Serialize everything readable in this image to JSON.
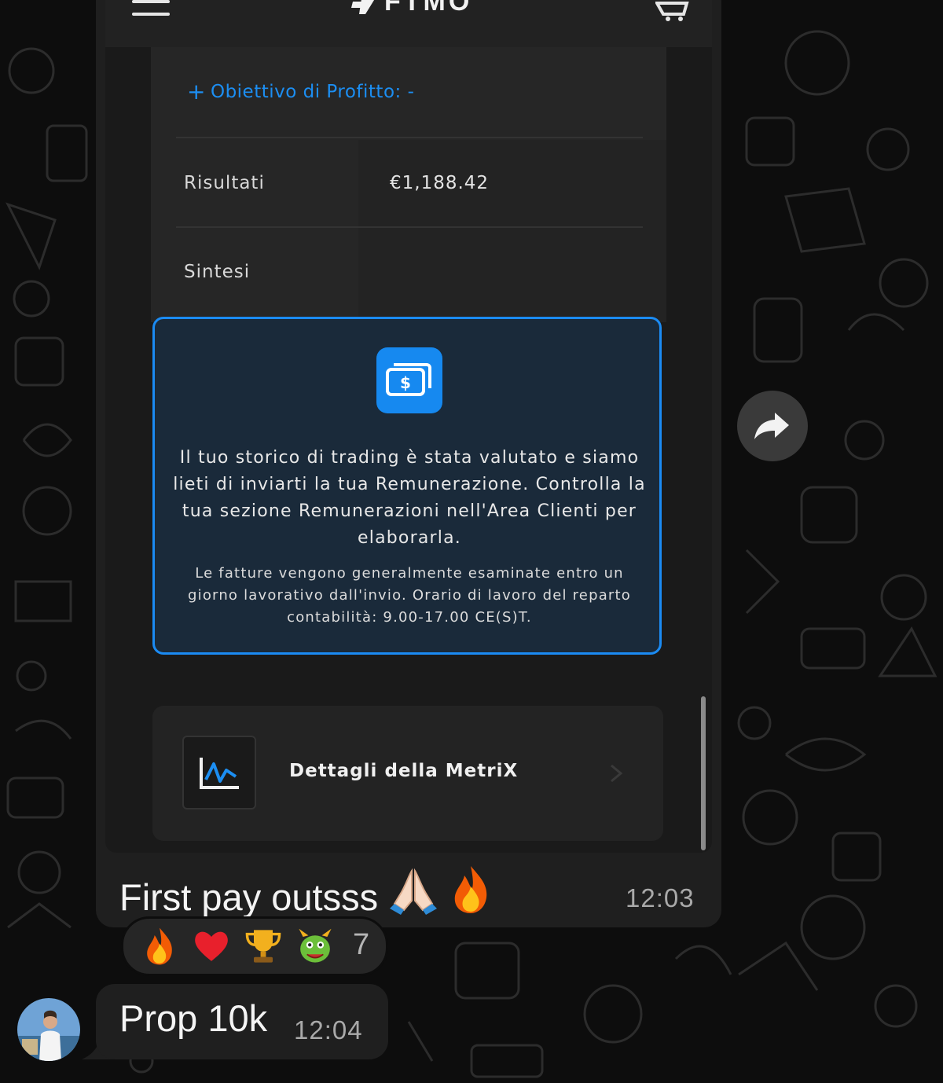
{
  "fake_app": {
    "logo_text": "FTMO",
    "profit_target": "Obiettivo di Profitto: -",
    "rows": [
      {
        "label": "Risultati",
        "value": "€1,188.42"
      },
      {
        "label": "Sintesi",
        "value": ""
      }
    ],
    "info_main": "Il tuo storico di trading è stata valutato e siamo lieti di inviarti la tua Remunerazione. Controlla la tua sezione Remunerazioni nell'Area Clienti per elaborarla.",
    "info_small": "Le fatture vengono generalmente esaminate entro un giorno lavorativo dall'invio. Orario di lavoro del reparto contabilità: 9.00-17.00 CE(S)T.",
    "metrix_label": "Dettagli della MetriX"
  },
  "message1": {
    "caption": "First pay outsss",
    "time": "12:03",
    "reactions": [
      "fire",
      "red-heart",
      "trophy",
      "dragon"
    ],
    "reaction_count": "7"
  },
  "message2": {
    "text": "Prop 10k",
    "time": "12:04"
  },
  "colors": {
    "accent_blue": "#1b8bf3",
    "bubble": "#1f1f1f",
    "background": "#0d0d0d"
  }
}
